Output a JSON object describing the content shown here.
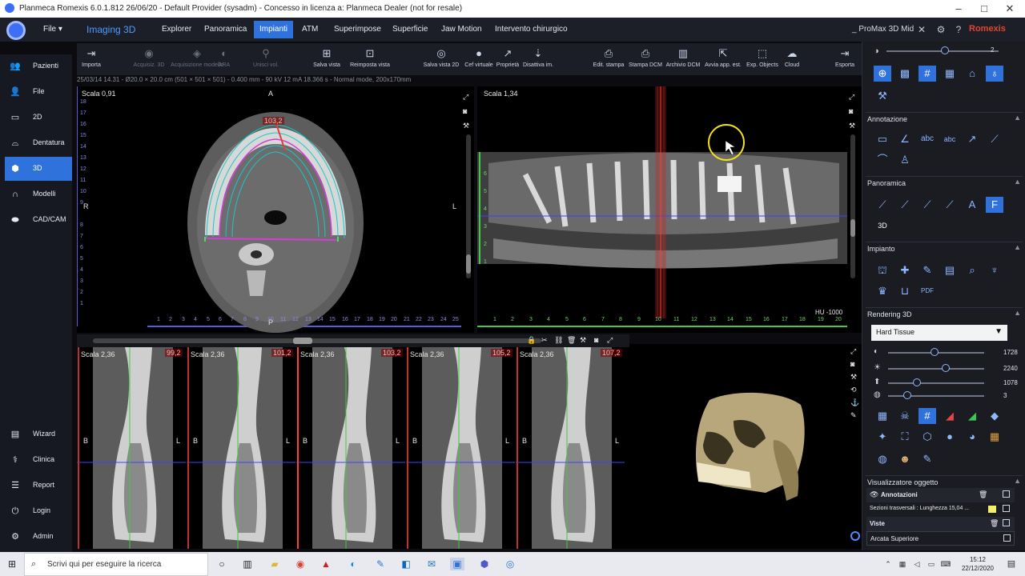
{
  "window": {
    "title": "Planmeca Romexis 6.0.1.812 26/06/20 - Default Provider (sysadm) - Concesso in licenza a: Planmeca Dealer (not for resale)",
    "controls": [
      "–",
      "□",
      "✕"
    ]
  },
  "menubar": {
    "file_label": "File",
    "module_title": "Imaging 3D",
    "tabs": [
      "Explorer",
      "Panoramica",
      "Impianti",
      "ATM",
      "Superimpose",
      "Superficie",
      "Jaw Motion",
      "Intervento chirurgico"
    ],
    "active_tab": "Impianti",
    "device": "_ ProMax 3D Mid",
    "brand": "Romexis"
  },
  "sidebar": {
    "items": [
      {
        "label": "Pazienti",
        "icon": "patients-icon",
        "glyph": "👥"
      },
      {
        "label": "File",
        "icon": "file-user-icon",
        "glyph": "👤"
      },
      {
        "label": "2D",
        "icon": "2d-icon",
        "glyph": "▭"
      },
      {
        "label": "Dentatura",
        "icon": "dentition-icon",
        "glyph": "⌓"
      },
      {
        "label": "3D",
        "icon": "cube-icon",
        "glyph": "⬢",
        "active": true
      },
      {
        "label": "Modelli",
        "icon": "model-icon",
        "glyph": "∩"
      },
      {
        "label": "CAD/CAM",
        "icon": "cadcam-icon",
        "glyph": "⬬"
      }
    ],
    "bottom_items": [
      {
        "label": "Wizard",
        "icon": "wizard-icon",
        "glyph": "▤"
      },
      {
        "label": "Clinica",
        "icon": "clinic-icon",
        "glyph": "⚕"
      },
      {
        "label": "Report",
        "icon": "report-icon",
        "glyph": "☰"
      },
      {
        "label": "Login",
        "icon": "login-icon",
        "glyph": "⏻"
      },
      {
        "label": "Admin",
        "icon": "admin-icon",
        "glyph": "⚙"
      }
    ]
  },
  "toolbar": {
    "buttons": [
      {
        "label": "Importa",
        "glyph": "⇥",
        "enabled": true
      },
      {
        "label": "Acquisiz. 3D",
        "glyph": "◉",
        "enabled": false
      },
      {
        "label": "Acquisizione modello",
        "glyph": "◈",
        "enabled": false
      },
      {
        "label": "ARA",
        "glyph": "◐",
        "enabled": false
      },
      {
        "label": "Unisci vol.",
        "glyph": "⚲",
        "enabled": false
      },
      {
        "label": "Salva vista",
        "glyph": "⊞",
        "enabled": true
      },
      {
        "label": "Reimposta vista",
        "glyph": "⊡",
        "enabled": true
      },
      {
        "label": "Salva vista 2D",
        "glyph": "◎",
        "enabled": true
      },
      {
        "label": "Cef virtuale",
        "glyph": "●",
        "enabled": true
      },
      {
        "label": "Proprietà",
        "glyph": "↗",
        "enabled": true
      },
      {
        "label": "Disattiva im.",
        "glyph": "⇣",
        "enabled": true
      },
      {
        "label": "Edit. stampa",
        "glyph": "⎙",
        "enabled": true
      },
      {
        "label": "Stampa DCM",
        "glyph": "⎙",
        "enabled": true
      },
      {
        "label": "Archivio DCM",
        "glyph": "▥",
        "enabled": true
      },
      {
        "label": "Avvia app. est.",
        "glyph": "⇱",
        "enabled": true
      },
      {
        "label": "Exp. Objects",
        "glyph": "⬚",
        "enabled": true
      },
      {
        "label": "Cloud",
        "glyph": "☁",
        "enabled": true
      },
      {
        "label": "Esporta",
        "glyph": "⇥",
        "enabled": true
      }
    ]
  },
  "info_line": "25/03/14 14.31 - Ø20.0 × 20.0 cm (501 × 501 × 501) - 0.400 mm - 90 kV 12 mA 18.366 s - Normal mode, 200x170mm",
  "axial": {
    "scale": "Scala 0,91",
    "top": "A",
    "bottom": "P",
    "left": "R",
    "right": "L",
    "arch_label": "103,2",
    "ruler_left": [
      "18",
      "17",
      "16",
      "15",
      "14",
      "13",
      "12",
      "11",
      "10",
      "9",
      "8",
      "7",
      "6",
      "5",
      "4",
      "3",
      "2",
      "1"
    ],
    "ruler_bottom": [
      "1",
      "2",
      "3",
      "4",
      "5",
      "6",
      "7",
      "8",
      "9",
      "10",
      "11",
      "12",
      "13",
      "14",
      "15",
      "16",
      "17",
      "18",
      "19",
      "20",
      "21",
      "22",
      "23",
      "24",
      "25"
    ]
  },
  "panoramic": {
    "scale": "Scala 1,34",
    "side": "L",
    "hu": "HU -1000",
    "ruler_left": [
      "6",
      "5",
      "4",
      "3",
      "2",
      "1"
    ],
    "ruler_bottom": [
      "1",
      "2",
      "3",
      "4",
      "5",
      "6",
      "7",
      "8",
      "9",
      "10",
      "11",
      "12",
      "13",
      "14",
      "15",
      "16",
      "17",
      "18",
      "19",
      "20"
    ]
  },
  "cross_sections": [
    {
      "scale": "Scala 2,36",
      "value": "99,2",
      "left": "B",
      "right": "L"
    },
    {
      "scale": "Scala 2,36",
      "value": "101,2",
      "left": "B",
      "right": "L"
    },
    {
      "scale": "Scala 2,36",
      "value": "103,2",
      "left": "B",
      "right": "L"
    },
    {
      "scale": "Scala 2,36",
      "value": "105,2",
      "left": "B",
      "right": "L"
    },
    {
      "scale": "Scala 2,36",
      "value": "107,2",
      "left": "B",
      "right": "L"
    }
  ],
  "cross_ruler": [
    "6",
    "5",
    "4",
    "3",
    "2",
    "1"
  ],
  "right_panel": {
    "top_slider_value": "2",
    "sections": {
      "annotazione": "Annotazione",
      "panoramica": "Panoramica",
      "impianto": "Impianto",
      "rendering": "Rendering 3D",
      "viewer": "Visualizzatore oggetto"
    },
    "rendering_preset": "Hard Tissue",
    "rendering_sliders": [
      {
        "icon": "contrast-icon",
        "glyph": "◐",
        "value": "1728",
        "level": 0.48
      },
      {
        "icon": "brightness-icon",
        "glyph": "☀",
        "value": "2240",
        "level": 0.6
      },
      {
        "icon": "opacity-icon",
        "glyph": "⬆",
        "value": "1078",
        "level": 0.3
      },
      {
        "icon": "smooth-icon",
        "glyph": "◍",
        "value": "3",
        "level": 0.2
      }
    ],
    "objects": [
      {
        "label": "Annotazioni",
        "bold": true
      },
      {
        "label": "Sezioni trasversali : Lunghezza 15,04 ...",
        "bold": false
      },
      {
        "label": "Viste",
        "bold": true
      },
      {
        "label": "Arcata Superiore",
        "bold": false
      }
    ]
  },
  "taskbar": {
    "search_placeholder": "Scrivi qui per eseguire la ricerca",
    "time": "15:12",
    "date": "22/12/2020"
  }
}
